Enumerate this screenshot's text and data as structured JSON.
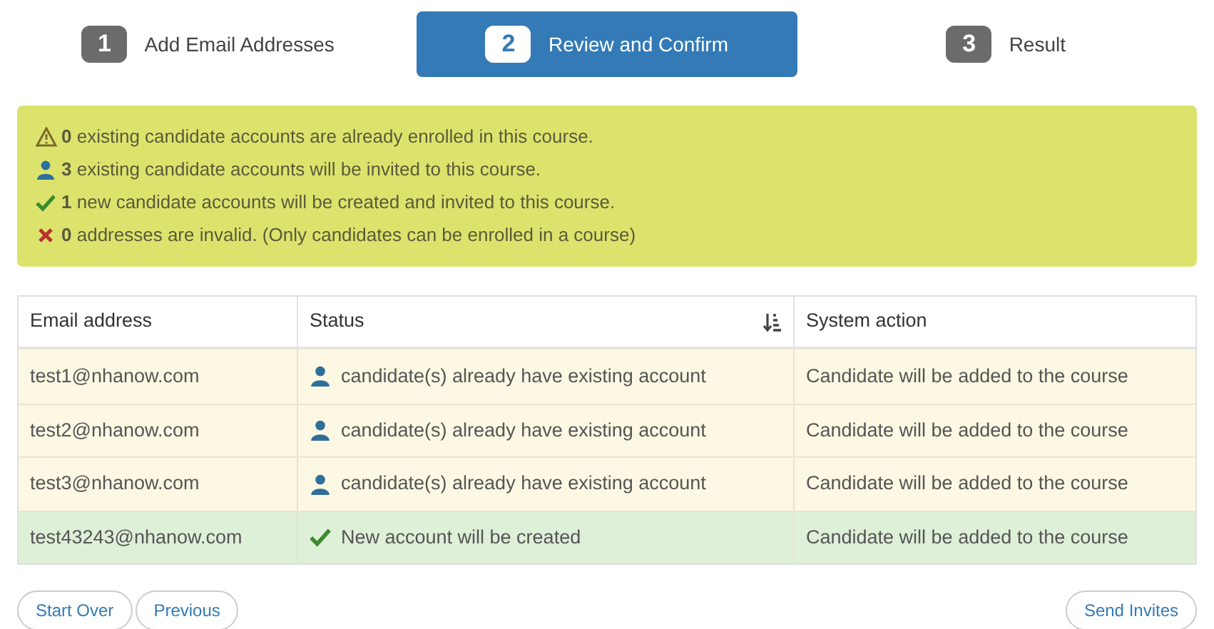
{
  "steps": [
    {
      "number": "1",
      "label": "Add Email Addresses",
      "selected": false
    },
    {
      "number": "2",
      "label": "Review and Confirm",
      "selected": true
    },
    {
      "number": "3",
      "label": "Result",
      "selected": false
    }
  ],
  "summary": [
    {
      "kind": "warning",
      "count": "0",
      "text": "existing candidate accounts are already enrolled in this course."
    },
    {
      "kind": "user",
      "count": "3",
      "text": "existing candidate accounts will be invited to this course."
    },
    {
      "kind": "check",
      "count": "1",
      "text": "new candidate accounts will be created and invited to this course."
    },
    {
      "kind": "cross",
      "count": "0",
      "text": "addresses are invalid. (Only candidates can be enrolled in a course)"
    }
  ],
  "table": {
    "columns": [
      "Email address",
      "Status",
      "System action"
    ],
    "rows": [
      {
        "kind": "existing",
        "email": "test1@nhanow.com",
        "status": "candidate(s) already have existing account",
        "action": "Candidate will be added to the course"
      },
      {
        "kind": "existing",
        "email": "test2@nhanow.com",
        "status": "candidate(s) already have existing account",
        "action": "Candidate will be added to the course"
      },
      {
        "kind": "existing",
        "email": "test3@nhanow.com",
        "status": "candidate(s) already have existing account",
        "action": "Candidate will be added to the course"
      },
      {
        "kind": "new",
        "email": "test43243@nhanow.com",
        "status": "New account will be created",
        "action": "Candidate will be added to the course"
      }
    ]
  },
  "buttons_left": [
    "Start Over",
    "Previous"
  ],
  "button_right": "Send Invites"
}
